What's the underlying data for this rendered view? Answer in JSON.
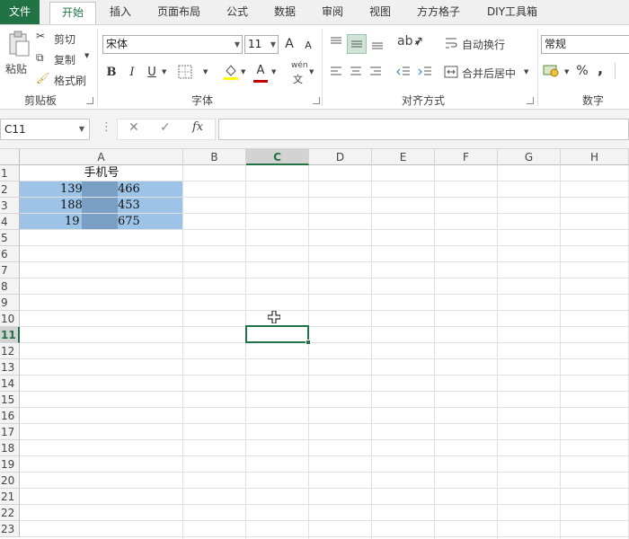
{
  "tabs": {
    "file": "文件",
    "home": "开始",
    "insert": "插入",
    "layout": "页面布局",
    "formulas": "公式",
    "data": "数据",
    "review": "审阅",
    "view": "视图",
    "fangfang": "方方格子",
    "diy": "DIY工具箱"
  },
  "ribbon": {
    "clipboard": {
      "paste": "粘贴",
      "cut": "剪切",
      "copy": "复制",
      "format_painter": "格式刷",
      "label": "剪贴板"
    },
    "font": {
      "name": "宋体",
      "size": "11",
      "bold": "B",
      "italic": "I",
      "underline": "U",
      "font_color": "A",
      "grow": "A",
      "shrink": "A",
      "phonetic": "wén",
      "label": "字体"
    },
    "alignment": {
      "wrap_text": "自动换行",
      "merge_center": "合并后居中",
      "label": "对齐方式"
    },
    "number": {
      "format": "常规",
      "percent": "%",
      "comma": ",",
      "label": "数字"
    }
  },
  "formula_bar": {
    "name_box": "C11",
    "fx": "fx",
    "cancel": "✕",
    "enter": "✓",
    "more": "⋮",
    "value": ""
  },
  "grid": {
    "columns": [
      "A",
      "B",
      "C",
      "D",
      "E",
      "F",
      "G",
      "H"
    ],
    "rows": [
      "1",
      "2",
      "3",
      "4",
      "5",
      "6",
      "7",
      "8",
      "9",
      "10",
      "11",
      "12",
      "13",
      "14",
      "15",
      "16",
      "17",
      "18",
      "19",
      "20",
      "21",
      "22",
      "23"
    ],
    "selected_column": "C",
    "selected_row": "11",
    "cells": {
      "A1": "手机号",
      "A2_left": "139",
      "A2_right": "466",
      "A3_left": "188",
      "A3_right": "453",
      "A4_left": "19",
      "A4_right": "675"
    }
  },
  "colors": {
    "accent": "#217346",
    "selection": "#9dc3e6",
    "redacted": "#7a9fc4"
  }
}
